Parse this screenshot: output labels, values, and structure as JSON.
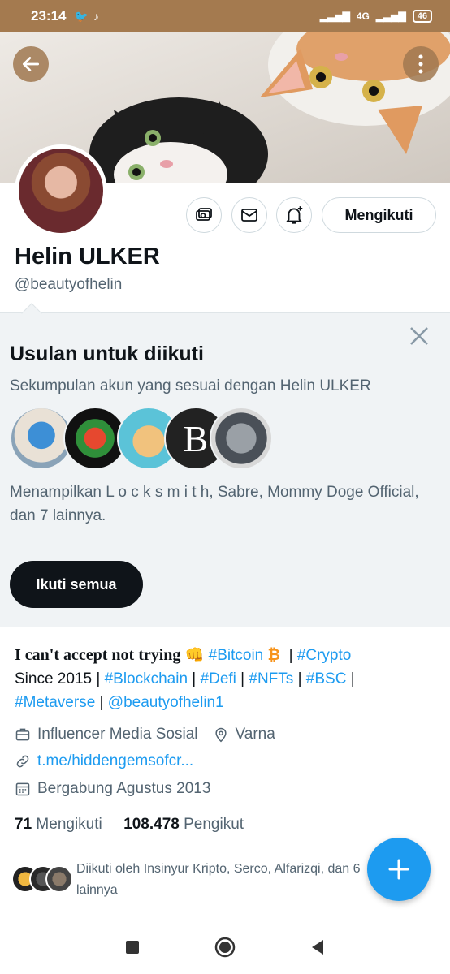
{
  "status_bar": {
    "time": "23:14",
    "net": "4G",
    "battery": "46"
  },
  "profile": {
    "follow_button": "Mengikuti",
    "name": "Helin ULKER",
    "handle": "@beautyofhelin"
  },
  "suggestions": {
    "title": "Usulan untuk diikuti",
    "subtitle": "Sekumpulan akun yang sesuai dengan Helin ULKER",
    "description": "Menampilkan L o c k s m i t h, Sabre, Mommy Doge Official, dan 7 lainnya.",
    "follow_all": "Ikuti semua"
  },
  "bio": {
    "line1_text": "I can't accept not trying",
    "tag_bitcoin": "#Bitcoin",
    "tag_crypto": "#Crypto",
    "since": "Since 2015 |",
    "tag_blockchain": "#Blockchain",
    "tag_defi": "#Defi",
    "tag_nfts": "#NFTs",
    "tag_bsc": "#BSC",
    "tag_metaverse": "#Metaverse",
    "mention": "@beautyofhelin1"
  },
  "meta": {
    "category": "Influencer Media Sosial",
    "location": "Varna",
    "link": "t.me/hiddengemsofcr...",
    "joined": "Bergabung Agustus 2013"
  },
  "counts": {
    "following_num": "71",
    "following_label": "Mengikuti",
    "followers_num": "108.478",
    "followers_label": "Pengikut"
  },
  "mutual": {
    "text": "Diikuti oleh Insinyur Kripto, Serco, Alfarizqi, dan 6 lainnya"
  },
  "icons": [
    "back-arrow-icon",
    "more-vertical-icon",
    "tip-jar-icon",
    "mail-icon",
    "bell-plus-icon",
    "close-icon",
    "briefcase-icon",
    "location-pin-icon",
    "link-icon",
    "calendar-icon",
    "compose-plus-icon"
  ]
}
